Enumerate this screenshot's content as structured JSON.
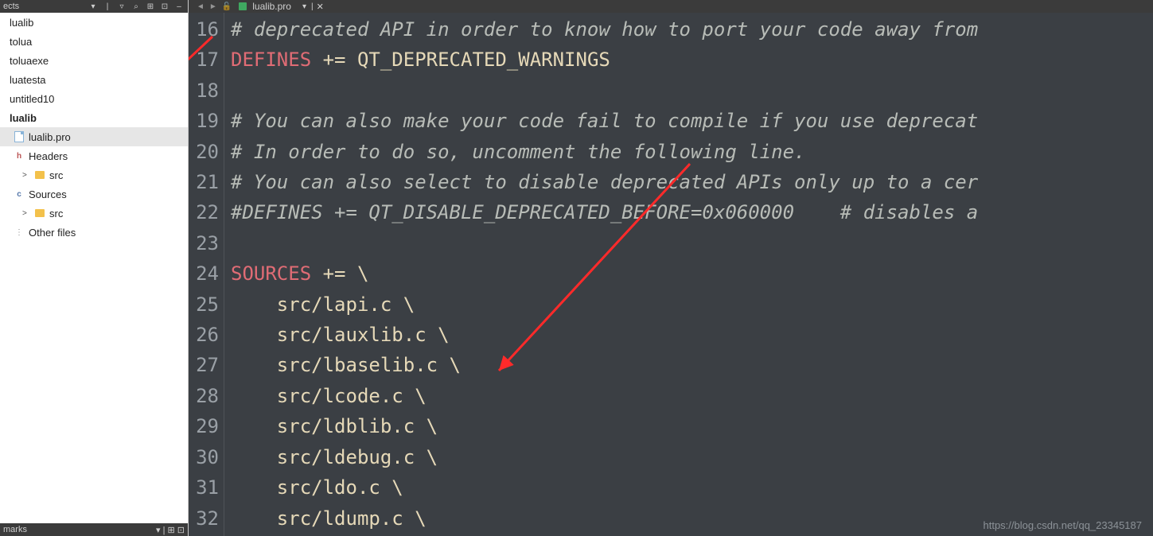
{
  "sidebar": {
    "top_title": "ects",
    "top_icons": [
      "chevron-down",
      "filter",
      "link",
      "split-h",
      "expand",
      "minimize"
    ],
    "items": [
      {
        "label": "lualib",
        "indent": 0,
        "bold": false,
        "selected": false,
        "icon": "none"
      },
      {
        "label": "tolua",
        "indent": 0,
        "bold": false,
        "selected": false,
        "icon": "none"
      },
      {
        "label": "toluaexe",
        "indent": 0,
        "bold": false,
        "selected": false,
        "icon": "none"
      },
      {
        "label": "luatesta",
        "indent": 0,
        "bold": false,
        "selected": false,
        "icon": "none"
      },
      {
        "label": "untitled10",
        "indent": 0,
        "bold": false,
        "selected": false,
        "icon": "none"
      },
      {
        "label": "lualib",
        "indent": 0,
        "bold": true,
        "selected": false,
        "icon": "none"
      },
      {
        "label": "lualib.pro",
        "indent": 1,
        "bold": false,
        "selected": true,
        "icon": "file"
      },
      {
        "label": "Headers",
        "indent": 1,
        "bold": false,
        "selected": false,
        "icon": "h"
      },
      {
        "label": "src",
        "indent": 2,
        "bold": false,
        "selected": false,
        "icon": "folder",
        "chev": ">"
      },
      {
        "label": "Sources",
        "indent": 1,
        "bold": false,
        "selected": false,
        "icon": "c"
      },
      {
        "label": "src",
        "indent": 2,
        "bold": false,
        "selected": false,
        "icon": "folder",
        "chev": ">"
      },
      {
        "label": "Other files",
        "indent": 1,
        "bold": false,
        "selected": false,
        "icon": "o"
      }
    ],
    "bottom_title": "marks",
    "bottom_icons": [
      "chevron-down",
      "split-h",
      "expand"
    ]
  },
  "tab": {
    "file_label": "lualib.pro",
    "closable": true
  },
  "editor": {
    "first_line": 16,
    "lines": [
      {
        "n": 16,
        "type": "comment",
        "text": "# deprecated API in order to know how to port your code away from"
      },
      {
        "n": 17,
        "type": "define",
        "kw": "DEFINES",
        "rest": " += QT_DEPRECATED_WARNINGS"
      },
      {
        "n": 18,
        "type": "blank",
        "text": ""
      },
      {
        "n": 19,
        "type": "comment",
        "text": "# You can also make your code fail to compile if you use deprecat"
      },
      {
        "n": 20,
        "type": "comment",
        "text": "# In order to do so, uncomment the following line."
      },
      {
        "n": 21,
        "type": "comment",
        "text": "# You can also select to disable deprecated APIs only up to a cer"
      },
      {
        "n": 22,
        "type": "comment",
        "text": "#DEFINES += QT_DISABLE_DEPRECATED_BEFORE=0x060000    # disables a"
      },
      {
        "n": 23,
        "type": "blank",
        "text": ""
      },
      {
        "n": 24,
        "type": "define",
        "kw": "SOURCES",
        "rest": " += \\"
      },
      {
        "n": 25,
        "type": "plain",
        "text": "    src/lapi.c \\"
      },
      {
        "n": 26,
        "type": "plain",
        "text": "    src/lauxlib.c \\"
      },
      {
        "n": 27,
        "type": "plain",
        "text": "    src/lbaselib.c \\"
      },
      {
        "n": 28,
        "type": "plain",
        "text": "    src/lcode.c \\"
      },
      {
        "n": 29,
        "type": "plain",
        "text": "    src/ldblib.c \\"
      },
      {
        "n": 30,
        "type": "plain",
        "text": "    src/ldebug.c \\"
      },
      {
        "n": 31,
        "type": "plain",
        "text": "    src/ldo.c \\"
      },
      {
        "n": 32,
        "type": "plain",
        "text": "    src/ldump.c \\"
      }
    ]
  },
  "watermark": "https://blog.csdn.net/qq_23345187"
}
